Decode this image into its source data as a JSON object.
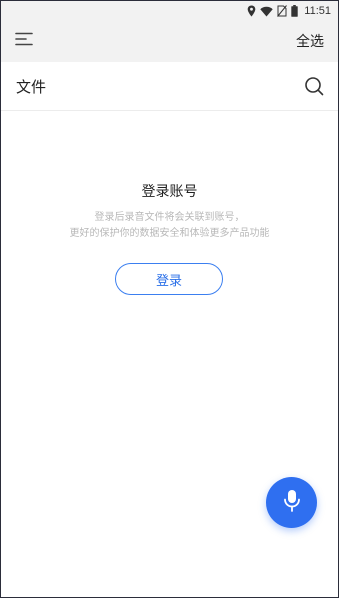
{
  "status_bar": {
    "time": "11:51",
    "icons": [
      "location-icon",
      "wifi-icon",
      "no-sim-icon",
      "battery-icon"
    ]
  },
  "header": {
    "menu_icon": "menu-icon",
    "select_all_label": "全选"
  },
  "files_bar": {
    "title": "文件",
    "search_icon": "search-icon"
  },
  "login_prompt": {
    "title": "登录账号",
    "description_line1": "登录后录音文件将会关联到账号，",
    "description_line2": "更好的保护你的数据安全和体验更多产品功能",
    "button_label": "登录"
  },
  "fab": {
    "icon": "microphone-icon"
  },
  "colors": {
    "accent": "#2f6ff0",
    "header_bg": "#f2f2f2",
    "muted_text": "#b8b8b8"
  }
}
